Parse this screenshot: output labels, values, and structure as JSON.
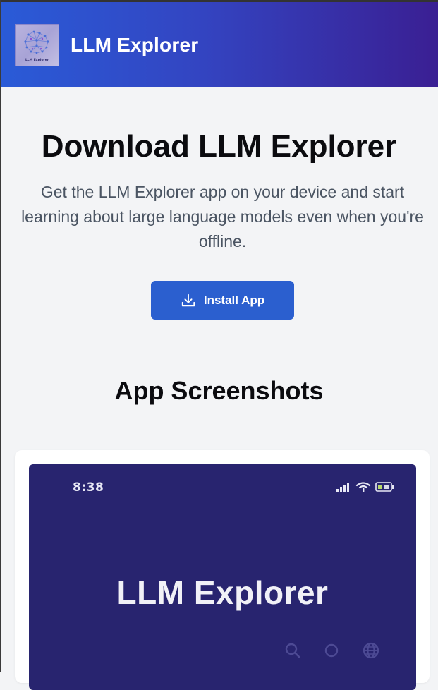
{
  "header": {
    "app_title": "LLM Explorer",
    "logo_text": "LLM Explorer"
  },
  "hero": {
    "title": "Download LLM Explorer",
    "description": "Get the LLM Explorer app on your device and start learning about large language models even when you're offline.",
    "install_label": "Install App",
    "install_icon": "download-icon"
  },
  "screenshots": {
    "title": "App Screenshots",
    "phone": {
      "time": "8:38",
      "app_name": "LLM Explorer",
      "status_icons": [
        "signal-icon",
        "wifi-icon",
        "battery-icon"
      ],
      "nav_icons": [
        "search-icon",
        "circle-icon",
        "globe-icon"
      ]
    }
  },
  "colors": {
    "header_start": "#2a5bd7",
    "header_end": "#3a1f93",
    "accent": "#2b5fcf",
    "background": "#f3f4f6",
    "phone_bg": "#28246f"
  }
}
